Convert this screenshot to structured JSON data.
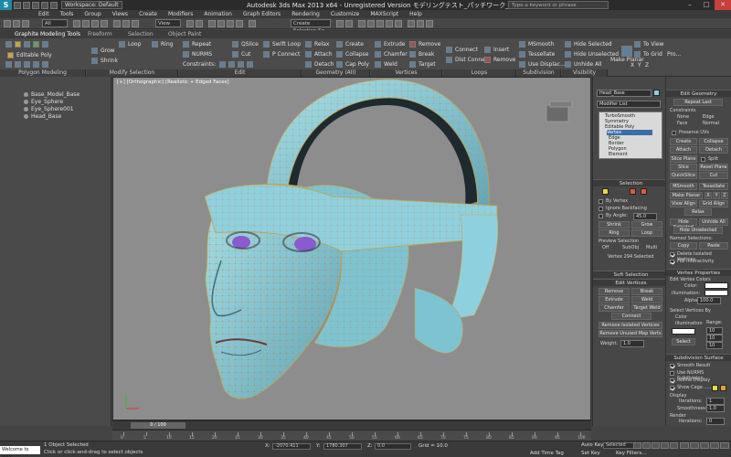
{
  "titlebar": {
    "workspace": "Workspace: Default",
    "title": "Autodesk 3ds Max  2013 x64    - Unregistered Version    モデリングテスト_パッチワーク_5.max",
    "search_placeholder": "Type a keyword or phrase"
  },
  "menu": [
    "Edit",
    "Tools",
    "Group",
    "Views",
    "Create",
    "Modifiers",
    "Animation",
    "Graph Editors",
    "Rendering",
    "Customize",
    "MAXScript",
    "Help"
  ],
  "toolbar": {
    "selection_filter": "All",
    "ref_coord": "View",
    "named_selection": "Create Selection Se"
  },
  "ribbon": {
    "tabs": [
      "Graphite Modeling Tools",
      "Freeform",
      "Selection",
      "Object Paint"
    ],
    "active_tab": "Graphite Modeling Tools",
    "subtitle": "Editable Poly",
    "polygon_modeling": "Polygon Modeling",
    "modify_selection": "Modify Selection",
    "groups": {
      "edit": "Edit",
      "geometry": "Geometry (All)",
      "vertices": "Vertices",
      "loops": "Loops",
      "subdivision": "Subdivision",
      "visibility": "Visibility"
    },
    "buttons": {
      "grow": "Grow",
      "shrink": "Shrink",
      "loop": "Loop",
      "ring": "Ring",
      "repeat": "Repeat",
      "qslice": "QSlice",
      "swift_loop": "Swift Loop",
      "nurms": "NURMS",
      "cut": "Cut",
      "p_connect": "P Connect",
      "constraints": "Constraints:",
      "relax": "Relax",
      "create": "Create",
      "attach": "Attach",
      "collapse": "Collapse",
      "detach": "Detach",
      "cap_poly": "Cap Poly",
      "extrude": "Extrude",
      "remove": "Remove",
      "chamfer": "Chamfer",
      "break": "Break",
      "weld": "Weld",
      "target": "Target",
      "connect": "Connect",
      "insert": "Insert",
      "dist_connect": "Dist Connect",
      "remove2": "Remove",
      "msmooth": "MSmooth",
      "tessellate": "Tessellate",
      "use_displac": "Use Displac...",
      "hide_selected": "Hide Selected",
      "hide_unselected": "Hide Unselected",
      "unhide_all": "Unhide All",
      "make_planar": "Make Planar",
      "x": "X",
      "y": "Y",
      "z": "Z",
      "to_view": "To View",
      "to_grid": "To Grid",
      "pro": "Pro..."
    }
  },
  "scene": {
    "items": [
      "Base_Model_Base",
      "Eye_Sphere",
      "Eye_Sphere001",
      "Head_Base"
    ]
  },
  "viewport": {
    "label": "[+] [Orthographic] [Realistic + Edged Faces]"
  },
  "modify_panel": {
    "object_name": "Head_Base",
    "modifier_list": "Modifier List",
    "stack": [
      "TurboSmooth",
      "Symmetry",
      "Editable Poly",
      "Vertex",
      "Edge",
      "Border",
      "Polygon",
      "Element"
    ],
    "selection_title": "Selection",
    "by_vertex": "By Vertex",
    "ignore_backfacing": "Ignore Backfacing",
    "by_angle": "By Angle:",
    "by_angle_value": "45.0",
    "shrink": "Shrink",
    "grow": "Grow",
    "ring": "Ring",
    "loop": "Loop",
    "preview_selection": "Preview Selection",
    "off": "Off",
    "subobj": "SubObj",
    "multi": "Multi",
    "selected_count": "Vertex 294 Selected",
    "soft_selection": "Soft Selection",
    "edit_vertices": "Edit Vertices",
    "remove": "Remove",
    "break": "Break",
    "extrude": "Extrude",
    "weld": "Weld",
    "chamfer": "Chamfer",
    "target_weld": "Target Weld",
    "connect": "Connect",
    "remove_isolated": "Remove Isolated Vertices",
    "remove_unused": "Remove Unused Map Verts",
    "weight": "Weight:",
    "weight_value": "1.0"
  },
  "edit_geometry": {
    "title": "Edit Geometry",
    "repeat_last": "Repeat Last",
    "constraints": "Constraints",
    "none": "None",
    "edge": "Edge",
    "face": "Face",
    "normal": "Normal",
    "preserve_uvs": "Preserve UVs",
    "create": "Create",
    "collapse": "Collapse",
    "attach": "Attach",
    "detach": "Detach",
    "slice_plane": "Slice Plane",
    "split": "Split",
    "slice": "Slice",
    "reset_plane": "Reset Plane",
    "quickslice": "QuickSlice",
    "cut": "Cut",
    "msmooth": "MSmooth",
    "tessellate": "Tessellate",
    "make_planar": "Make Planar",
    "x": "X",
    "y": "Y",
    "z": "Z",
    "view_align": "View Align",
    "grid_align": "Grid Align",
    "relax": "Relax",
    "hide_selected": "Hide Selected",
    "unhide_all": "Unhide All",
    "hide_unselected": "Hide Unselected",
    "named_selections": "Named Selections:",
    "copy": "Copy",
    "paste": "Paste",
    "delete_isolated": "Delete Isolated Vertices",
    "full_interactivity": "Full Interactivity",
    "vertex_properties": "Vertex Properties",
    "edit_vertex_colors": "Edit Vertex Colors",
    "color": "Color:",
    "illumination": "Illumination:",
    "alpha": "Alpha:",
    "alpha_value": "100.0",
    "select_vertices_by": "Select Vertices By",
    "color_radio": "Color",
    "illumination_radio": "Illumination",
    "range": "Range:",
    "range_r": "10",
    "range_g": "10",
    "range_b": "10",
    "select": "Select",
    "subdivision_surface": "Subdivision Surface",
    "smooth_result": "Smooth Result",
    "use_nurms": "Use NURMS Subdivision",
    "isoline_display": "Isoline Display",
    "show_cage": "Show Cage......",
    "display": "Display",
    "iterations": "Iterations:",
    "iterations_value": "1",
    "smoothness": "Smoothness:",
    "smoothness_value": "1.0",
    "render": "Render",
    "r_iterations_value": "0",
    "r_smoothness_value": "1.0"
  },
  "timeline": {
    "frame": "0 / 100",
    "ticks": [
      "0",
      "5",
      "10",
      "15",
      "20",
      "25",
      "30",
      "35",
      "40",
      "45",
      "50",
      "55",
      "60",
      "65",
      "70",
      "75",
      "80",
      "85",
      "90",
      "95",
      "100"
    ]
  },
  "status": {
    "listener": "Welcome to MAX",
    "objects_selected": "1 Object Selected",
    "prompt": "Click or click-and-drag to select objects",
    "x_label": "X:",
    "x_value": "-2070.411",
    "y_label": "Y:",
    "y_value": "1780.307",
    "z_label": "Z:",
    "z_value": "0.0",
    "grid": "Grid = 10.0",
    "auto_key": "Auto Key",
    "selected": "Selected",
    "set_key": "Set Key",
    "key_filters": "Key Filters...",
    "add_time_tag": "Add Time Tag"
  },
  "colors": {
    "accent": "#3a6ea5",
    "mesh": "#8fd0de",
    "wire": "#c2a24a",
    "vertex": "#d4452a",
    "eye": "#8a5ad0",
    "viewport_bg": "#8d8d8d"
  }
}
